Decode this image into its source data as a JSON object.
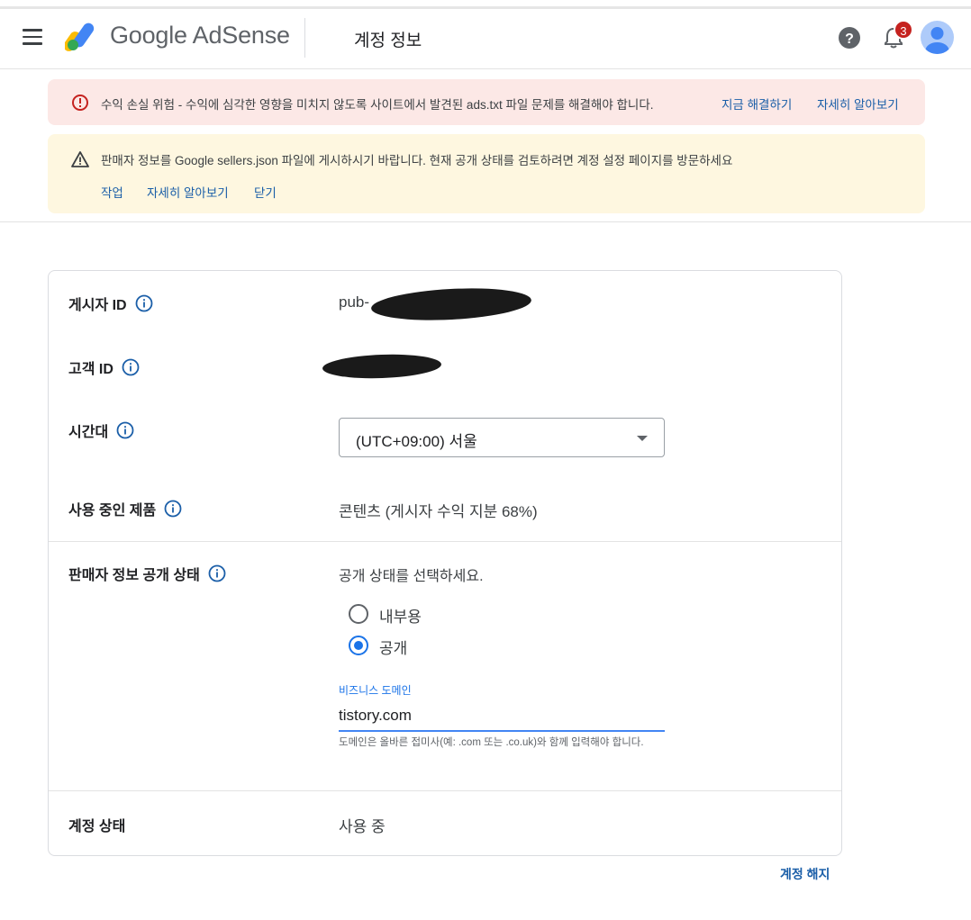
{
  "header": {
    "brand": "Google AdSense",
    "page_title": "계정 정보",
    "notification_count": "3",
    "icons": [
      "menu-icon",
      "adsense-logo-icon",
      "help-icon",
      "bell-icon",
      "avatar-icon"
    ]
  },
  "alerts": {
    "error": {
      "message": "수익 손실 위험 - 수익에 심각한 영향을 미치지 않도록 사이트에서 발견된 ads.txt 파일 문제를 해결해야 합니다.",
      "fix_label": "지금 해결하기",
      "learn_more_label": "자세히 알아보기"
    },
    "warning": {
      "message": "판매자 정보를 Google sellers.json 파일에 게시하시기 바랍니다. 현재 공개 상태를 검토하려면 계정 설정 페이지를 방문하세요",
      "action_label": "작업",
      "learn_more_label": "자세히 알아보기",
      "close_label": "닫기"
    }
  },
  "account": {
    "publisher_id_label": "게시자 ID",
    "publisher_id_value": "pub-",
    "customer_id_label": "고객 ID",
    "timezone_label": "시간대",
    "timezone_value": "(UTC+09:00) 서울",
    "products_label": "사용 중인 제품",
    "products_value": "콘텐츠 (게시자 수익 지분 68%)",
    "seller_visibility_label": "판매자 정보 공개 상태",
    "seller_visibility_prompt": "공개 상태를 선택하세요.",
    "visibility_options": [
      "내부용",
      "공개"
    ],
    "visibility_selected": "공개",
    "business_domain_label": "비즈니스 도메인",
    "business_domain_value": "tistory.com",
    "business_domain_hint": "도메인은 올바른 접미사(예: .com 또는 .co.uk)와 함께 입력해야 합니다.",
    "account_status_label": "계정 상태",
    "account_status_value": "사용 중",
    "terminate_label": "계정 해지"
  },
  "colors": {
    "link": "#1a5ea8",
    "error_bg": "#fce8e6",
    "warning_bg": "#fef7e0",
    "accent": "#1a73e8",
    "badge": "#c5221f"
  }
}
